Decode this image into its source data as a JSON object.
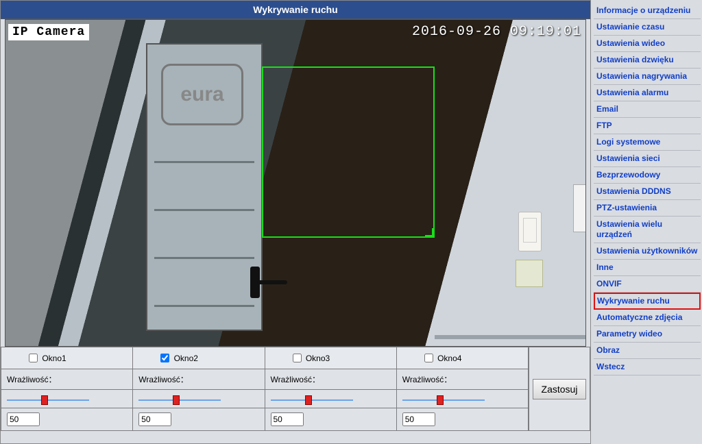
{
  "header": {
    "title": "Wykrywanie ruchu"
  },
  "video": {
    "label": "IP Camera",
    "timestamp": "2016-09-26 09:19:01",
    "logo_text": "eura"
  },
  "windows": [
    {
      "label": "Okno1",
      "checked": false,
      "sensitivity_label": "Wrażliwość：",
      "value": "50",
      "thumb_pct": 50
    },
    {
      "label": "Okno2",
      "checked": true,
      "sensitivity_label": "Wrażliwość：",
      "value": "50",
      "thumb_pct": 50
    },
    {
      "label": "Okno3",
      "checked": false,
      "sensitivity_label": "Wrażliwość：",
      "value": "50",
      "thumb_pct": 50
    },
    {
      "label": "Okno4",
      "checked": false,
      "sensitivity_label": "Wrażliwość：",
      "value": "50",
      "thumb_pct": 50
    }
  ],
  "apply": {
    "label": "Zastosuj"
  },
  "nav": {
    "active_index": 16,
    "items": [
      "Informacje o urządzeniu",
      "Ustawianie czasu",
      "Ustawienia wideo",
      "Ustawienia dzwięku",
      "Ustawienia nagrywania",
      "Ustawienia alarmu",
      "Email",
      "FTP",
      "Logi systemowe",
      "Ustawienia sieci",
      "Bezprzewodowy",
      "Ustawienia DDDNS",
      "PTZ-ustawienia",
      "Ustawienia wielu urządzeń",
      "Ustawienia użytkowników",
      "Inne",
      "ONVIF",
      "Wykrywanie ruchu",
      "Automatyczne zdjęcia",
      "Parametry wideo",
      "Obraz",
      "Wstecz"
    ]
  }
}
